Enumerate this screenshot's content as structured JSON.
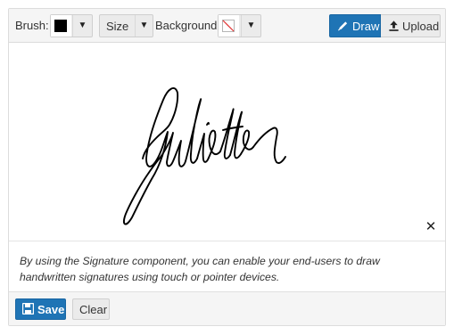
{
  "toolbar": {
    "brush_label": "Brush:",
    "brush_color": "#000000",
    "size_label": "Size",
    "background_label": "Background:",
    "draw_label": "Draw",
    "upload_label": "Upload",
    "draw_icon": "pen-icon",
    "upload_icon": "upload-icon",
    "dropdown_icon": "caret-down-icon"
  },
  "canvas": {
    "signature_text": "Juliette",
    "close_icon": "close-icon"
  },
  "description": {
    "text": "By using the Signature component, you can enable your end-users to draw handwritten signatures using touch or pointer devices."
  },
  "footer": {
    "save_label": "Save",
    "save_icon": "floppy-disk-icon",
    "clear_label": "Clear"
  },
  "colors": {
    "accent": "#1f74b5",
    "toolbar_bg": "#f5f5f5",
    "button_bg": "#ebebeb"
  }
}
